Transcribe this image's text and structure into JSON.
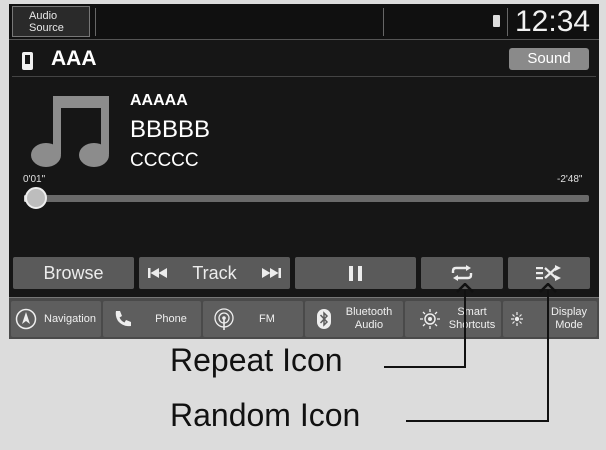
{
  "topbar": {
    "audio_source_label": "Audio\nSource",
    "clock": "12:34",
    "usb_icon": "usb-icon"
  },
  "source": {
    "name": "AAA",
    "icon": "usb-icon",
    "sound_button": "Sound"
  },
  "track": {
    "artist": "AAAAA",
    "title": "BBBBB",
    "album": "CCCCC",
    "elapsed": "0'01\"",
    "remaining": "-2'48\"",
    "progress_fraction": 0.005,
    "art_icon": "music-note-icon"
  },
  "controls": {
    "browse": "Browse",
    "track": "Track",
    "prev_icon": "skip-back-icon",
    "next_icon": "skip-forward-icon",
    "pause_icon": "pause-icon",
    "repeat_icon": "repeat-icon",
    "random_icon": "random-icon"
  },
  "nav": {
    "navigation": "Navigation",
    "phone": "Phone",
    "fm": "FM",
    "bluetooth": "Bluetooth\nAudio",
    "shortcuts": "Smart\nShortcuts",
    "display": "Display\nMode"
  },
  "callouts": {
    "repeat": "Repeat Icon",
    "random": "Random Icon"
  },
  "colors": {
    "screen_bg": "#161616",
    "button_bg": "#5a5a5a",
    "nav_bg": "#4a4a4a",
    "page_bg": "#dcdcdc"
  }
}
